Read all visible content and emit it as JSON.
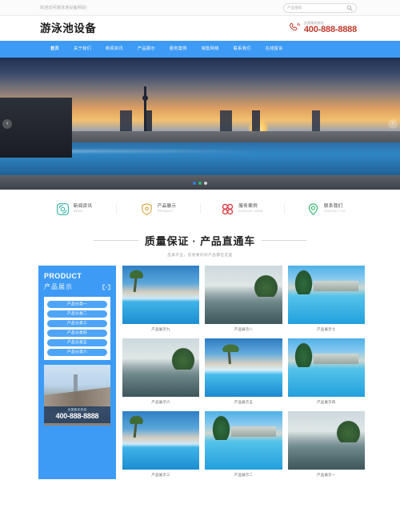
{
  "topbar": {
    "welcome": "欢迎访问游泳池设备网站!",
    "search_value": "",
    "search_placeholder": "产品搜索",
    "search_icon": "search-icon"
  },
  "header": {
    "logo": "游泳池设备",
    "phone_icon": "phone-icon",
    "phone_label": "全国服务热线:",
    "phone_number": "400-888-8888"
  },
  "nav": {
    "items": [
      {
        "label": "首页",
        "active": true
      },
      {
        "label": "关于我们",
        "active": false
      },
      {
        "label": "新闻资讯",
        "active": false
      },
      {
        "label": "产品展示",
        "active": false
      },
      {
        "label": "服务案例",
        "active": false
      },
      {
        "label": "销售网络",
        "active": false
      },
      {
        "label": "联系我们",
        "active": false
      },
      {
        "label": "在线留言",
        "active": false
      }
    ]
  },
  "banner": {
    "prev_icon": "chevron-left-icon",
    "next_icon": "chevron-right-icon",
    "prev_label": "‹",
    "next_label": "›",
    "dots": [
      "active",
      "green",
      "grey"
    ]
  },
  "features": [
    {
      "cn": "新闻资讯",
      "en": "NEWS",
      "icon": "news-icon",
      "color": "#3ab5a8"
    },
    {
      "cn": "产品展示",
      "en": "PRODUCT",
      "icon": "shield-icon",
      "color": "#d9a441"
    },
    {
      "cn": "服务案例",
      "en": "DISPLAY CASE",
      "icon": "grid-circles-icon",
      "color": "#e0434b"
    },
    {
      "cn": "联系我们",
      "en": "CONTACT US",
      "icon": "location-pin-icon",
      "color": "#3cb878"
    }
  ],
  "section": {
    "title": "质量保证 · 产品直通车",
    "subtitle": "品类齐全，您想要的好产品都在这里"
  },
  "sidebar": {
    "title_en": "PRODUCT",
    "title_cn": "产品展示",
    "expand_icon": "expand-icon",
    "categories": [
      "产品分类一",
      "产品分类二",
      "产品分类三",
      "产品分类四",
      "产品分类五",
      "产品分类六"
    ],
    "promo": {
      "label": "全国服务热线",
      "number": "400-888-8888",
      "image": "city-skyline-photo"
    }
  },
  "products": [
    {
      "caption": "产品展示九",
      "image": "pool-palm-photo",
      "variant": "pv-palm"
    },
    {
      "caption": "产品展示八",
      "image": "pool-lake-photo",
      "variant": "pv-lake"
    },
    {
      "caption": "产品展示七",
      "image": "pool-villa-photo",
      "variant": "pv-villa"
    },
    {
      "caption": "产品展示六",
      "image": "pool-lake-photo",
      "variant": "pv-lake"
    },
    {
      "caption": "产品展示五",
      "image": "pool-palm2-photo",
      "variant": "pv-palm2"
    },
    {
      "caption": "产品展示四",
      "image": "pool-villa-photo",
      "variant": "pv-villa"
    },
    {
      "caption": "产品展示三",
      "image": "pool-palm-photo",
      "variant": "pv-palm"
    },
    {
      "caption": "产品展示二",
      "image": "pool-villa-photo",
      "variant": "pv-villa"
    },
    {
      "caption": "产品展示一",
      "image": "pool-lake-photo",
      "variant": "pv-lake"
    }
  ],
  "colors": {
    "brand_blue": "#3d9bf5",
    "phone_red": "#c0392b",
    "text_dark": "#232323"
  }
}
